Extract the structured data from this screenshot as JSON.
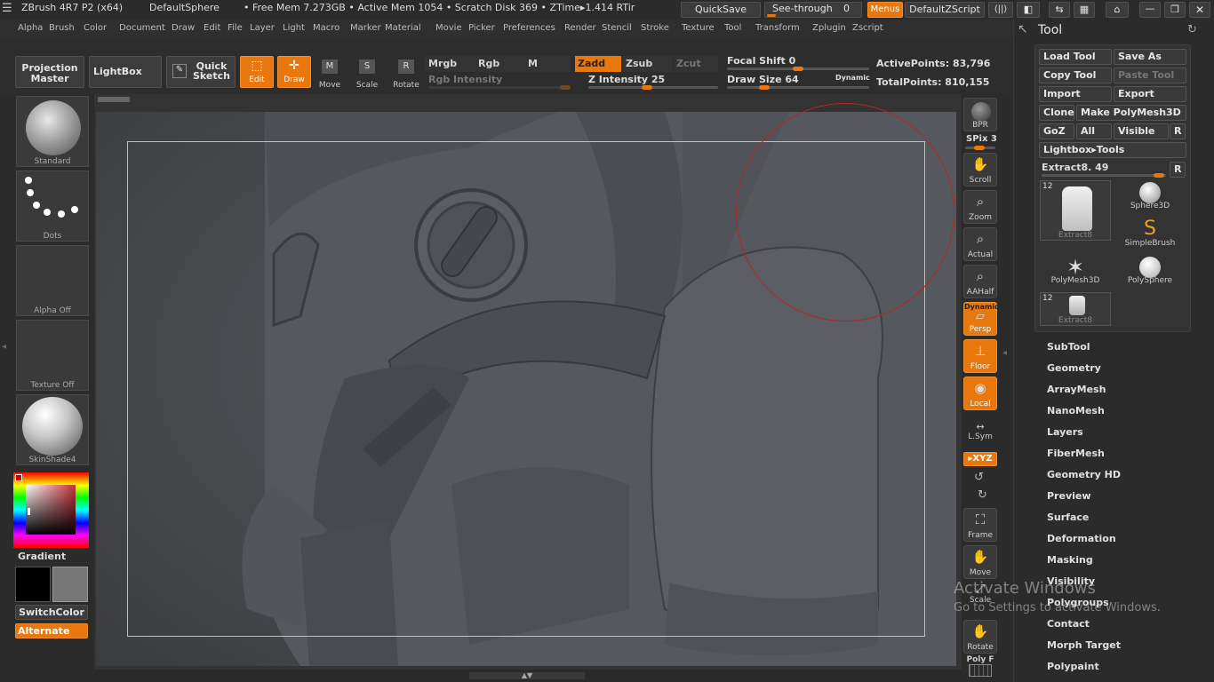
{
  "titlebar": {
    "app": "ZBrush 4R7 P2 (x64)",
    "document": "DefaultSphere",
    "stats": "• Free Mem 7.273GB • Active Mem 1054 • Scratch Disk 369 •  ZTime▸1.414 RTir",
    "quicksave": "QuickSave",
    "seethrough": "See-through",
    "seethrough_value": "0",
    "menus": "Menus",
    "zscript": "DefaultZScript"
  },
  "menubar": [
    "Alpha",
    "Brush",
    "Color",
    "Document",
    "Draw",
    "Edit",
    "File",
    "Layer",
    "Light",
    "Macro",
    "Marker",
    "Material",
    "Movie",
    "Picker",
    "Preferences",
    "Render",
    "Stencil",
    "Stroke",
    "Texture",
    "Tool",
    "Transform",
    "Zplugin",
    "Zscript"
  ],
  "toolbar": {
    "projection_master": "Projection Master",
    "lightbox": "LightBox",
    "quick_sketch": "Quick Sketch",
    "edit": "Edit",
    "draw": "Draw",
    "move": "Move",
    "scale": "Scale",
    "rotate": "Rotate",
    "mrgb": "Mrgb",
    "rgb": "Rgb",
    "m": "M",
    "zadd": "Zadd",
    "zsub": "Zsub",
    "zcut": "Zcut",
    "rgb_intensity": "Rgb Intensity",
    "z_intensity": "Z Intensity 25",
    "focal_shift": "Focal Shift 0",
    "draw_size": "Draw Size 64",
    "dynamic": "Dynamic",
    "active_points": "ActivePoints: 83,796",
    "total_points": "TotalPoints: 810,155"
  },
  "leftshelf": {
    "brush": "Standard",
    "stroke": "Dots",
    "alpha": "Alpha  Off",
    "texture": "Texture  Off",
    "material": "SkinShade4",
    "gradient": "Gradient",
    "switchcolor": "SwitchColor",
    "alternate": "Alternate"
  },
  "rightshelf": {
    "bpr": "BPR",
    "spix": "SPix 3",
    "scroll": "Scroll",
    "zoom": "Zoom",
    "actual": "Actual",
    "aahalf": "AAHalf",
    "dynamic": "Dynamic",
    "persp": "Persp",
    "floor": "Floor",
    "local": "Local",
    "lsym": "L.Sym",
    "xyz": "▸XYZ",
    "frame": "Frame",
    "move": "Move",
    "scale": "Scale",
    "rotate": "Rotate",
    "polyf": "Poly F"
  },
  "toolpanel": {
    "title": "Tool",
    "load_tool": "Load Tool",
    "save_as": "Save As",
    "copy_tool": "Copy Tool",
    "paste_tool": "Paste Tool",
    "import": "Import",
    "export": "Export",
    "clone": "Clone",
    "make_polymesh": "Make PolyMesh3D",
    "goz": "GoZ",
    "all": "All",
    "visible": "Visible",
    "r": "R",
    "lightbox_tools": "Lightbox▸Tools",
    "extract_slider": "Extract8. 49",
    "tools": [
      {
        "name": "Extract8",
        "count": "12"
      },
      {
        "name": "Sphere3D",
        "count": ""
      },
      {
        "name": "SimpleBrush",
        "count": ""
      },
      {
        "name": "PolyMesh3D",
        "count": ""
      },
      {
        "name": "PolySphere",
        "count": ""
      },
      {
        "name": "Extract8",
        "count": "12"
      }
    ],
    "sections": [
      "SubTool",
      "Geometry",
      "ArrayMesh",
      "NanoMesh",
      "Layers",
      "FiberMesh",
      "Geometry HD",
      "Preview",
      "Surface",
      "Deformation",
      "Masking",
      "Visibility",
      "Polygroups",
      "Contact",
      "Morph Target",
      "Polypaint"
    ]
  },
  "watermark": {
    "line1": "Activate Windows",
    "line2": "Go to Settings to activate Windows."
  },
  "colors": {
    "accent": "#e8780e",
    "canvas": "#4a4c50",
    "panel": "#2b2b2b"
  }
}
